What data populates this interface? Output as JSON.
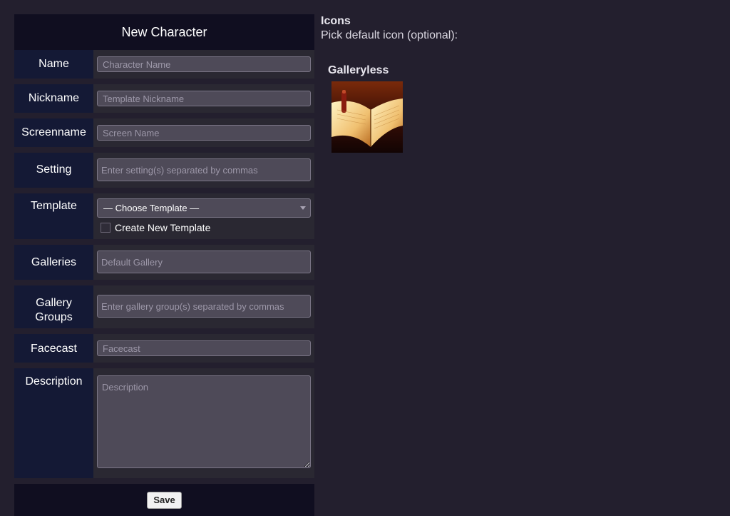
{
  "form": {
    "title": "New Character",
    "fields": {
      "name": {
        "label": "Name",
        "placeholder": "Character Name"
      },
      "nickname": {
        "label": "Nickname",
        "placeholder": "Template Nickname"
      },
      "screenname": {
        "label": "Screenname",
        "placeholder": "Screen Name"
      },
      "setting": {
        "label": "Setting",
        "placeholder": "Enter setting(s) separated by commas"
      },
      "template": {
        "label": "Template",
        "selected": "— Choose Template —",
        "checkbox_label": "Create New Template"
      },
      "galleries": {
        "label": "Galleries",
        "placeholder": "Default Gallery"
      },
      "gallery_groups": {
        "label_line1": "Gallery",
        "label_line2": "Groups",
        "placeholder": "Enter gallery group(s) separated by commas"
      },
      "facecast": {
        "label": "Facecast",
        "placeholder": "Facecast"
      },
      "description": {
        "label": "Description",
        "placeholder": "Description"
      }
    },
    "save_label": "Save"
  },
  "icons": {
    "heading": "Icons",
    "subtitle": "Pick default icon (optional):",
    "gallery_name": "Galleryless",
    "thumbnail_icon": "open-book-icon"
  }
}
